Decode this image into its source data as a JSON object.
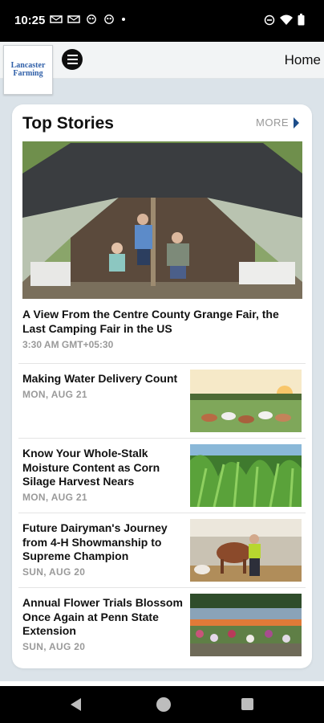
{
  "status_bar": {
    "time": "10:25",
    "icons": [
      "mail-icon",
      "mail-icon",
      "app-icon",
      "app-icon",
      "dot-icon",
      "dnd-icon",
      "wifi-icon",
      "battery-icon"
    ]
  },
  "header": {
    "logo_line1": "Lancaster",
    "logo_line2": "Farming",
    "home_label": "Home"
  },
  "top_stories": {
    "title": "Top Stories",
    "more_label": "MORE",
    "hero": {
      "title": "A View From the Centre County Grange Fair, the Last Camping Fair in the US",
      "time": "3:30 AM GMT+05:30"
    },
    "items": [
      {
        "title": "Making Water Delivery Count",
        "date": "MON, AUG 21"
      },
      {
        "title": "Know Your Whole-Stalk Moisture Content as Corn Silage Harvest Nears",
        "date": "MON, AUG 21"
      },
      {
        "title": "Future Dairyman's Journey from 4-H Showmanship to Supreme Champion",
        "date": "SUN, AUG 20"
      },
      {
        "title": "Annual Flower Trials Blossom Once Again at Penn State Extension",
        "date": "SUN, AUG 20"
      }
    ]
  },
  "colors": {
    "page_bg": "#dbe3e9",
    "accent": "#1c4d8a",
    "meta_text": "#9a9a9a"
  }
}
